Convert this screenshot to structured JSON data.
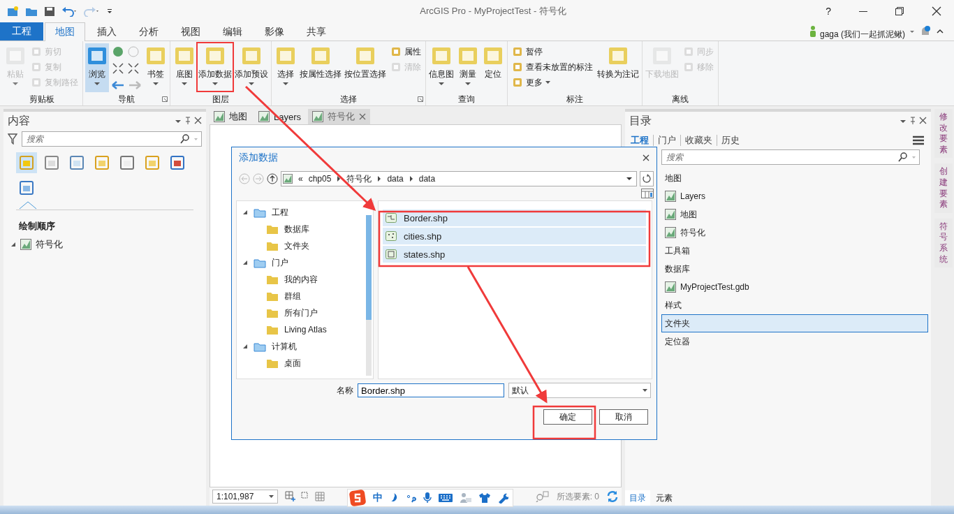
{
  "window": {
    "title": "ArcGIS Pro - MyProjectTest - 符号化",
    "help": "?"
  },
  "file_tab": "工程",
  "ribbon_tabs": [
    {
      "label": "地图",
      "selected": true
    },
    {
      "label": "插入",
      "selected": false
    },
    {
      "label": "分析",
      "selected": false
    },
    {
      "label": "视图",
      "selected": false
    },
    {
      "label": "编辑",
      "selected": false
    },
    {
      "label": "影像",
      "selected": false
    },
    {
      "label": "共享",
      "selected": false
    }
  ],
  "user": {
    "name": "gaga (我们一起抓泥鳅)"
  },
  "ribbon_groups": [
    {
      "label": "剪贴板",
      "launcher": false,
      "buttons": [
        {
          "label": "粘贴",
          "kind": "large",
          "disabled": true,
          "pressed": false,
          "dropdown": true
        },
        {
          "label": "剪切",
          "kind": "small",
          "disabled": true,
          "pressed": false,
          "dropdown": false
        },
        {
          "label": "复制",
          "kind": "small",
          "disabled": true,
          "pressed": false,
          "dropdown": false
        },
        {
          "label": "复制路径",
          "kind": "small",
          "disabled": true,
          "pressed": false,
          "dropdown": false
        }
      ]
    },
    {
      "label": "导航",
      "launcher": true,
      "buttons": [
        {
          "label": "浏览",
          "kind": "large",
          "disabled": false,
          "pressed": true,
          "dropdown": true
        },
        {
          "kind": "nav_cluster"
        },
        {
          "label": "书签",
          "kind": "large",
          "disabled": false,
          "pressed": false,
          "dropdown": true
        }
      ]
    },
    {
      "label": "图层",
      "launcher": false,
      "buttons": [
        {
          "label": "底图",
          "kind": "large",
          "disabled": false,
          "pressed": false,
          "dropdown": true
        },
        {
          "label": "添加数据",
          "kind": "large",
          "disabled": false,
          "pressed": false,
          "dropdown": true
        },
        {
          "label": "添加预设",
          "kind": "large",
          "disabled": false,
          "pressed": false,
          "dropdown": true
        }
      ]
    },
    {
      "label": "选择",
      "launcher": true,
      "buttons": [
        {
          "label": "选择",
          "kind": "large",
          "disabled": false,
          "pressed": false,
          "dropdown": true
        },
        {
          "label": "按属性选择",
          "kind": "large",
          "disabled": false,
          "pressed": false,
          "dropdown": false
        },
        {
          "label": "按位置选择",
          "kind": "large",
          "disabled": false,
          "pressed": false,
          "dropdown": false
        },
        {
          "label": "属性",
          "kind": "small",
          "disabled": false,
          "pressed": false,
          "dropdown": false
        },
        {
          "label": "清除",
          "kind": "small",
          "disabled": true,
          "pressed": false,
          "dropdown": false
        }
      ]
    },
    {
      "label": "查询",
      "launcher": false,
      "buttons": [
        {
          "label": "信息图",
          "kind": "large",
          "disabled": false,
          "pressed": false,
          "dropdown": true
        },
        {
          "label": "测量",
          "kind": "large",
          "disabled": false,
          "pressed": false,
          "dropdown": true
        },
        {
          "label": "定位",
          "kind": "large",
          "disabled": false,
          "pressed": false,
          "dropdown": false
        }
      ]
    },
    {
      "label": "标注",
      "launcher": false,
      "buttons": [
        {
          "label": "暂停",
          "kind": "small",
          "disabled": false,
          "pressed": false,
          "dropdown": false
        },
        {
          "label": "查看未放置的标注",
          "kind": "small",
          "disabled": false,
          "pressed": false,
          "dropdown": false
        },
        {
          "label": "更多",
          "kind": "small",
          "disabled": false,
          "pressed": false,
          "dropdown": true
        },
        {
          "label": "转换为注记",
          "kind": "large",
          "disabled": false,
          "pressed": false,
          "dropdown": false
        }
      ]
    },
    {
      "label": "离线",
      "launcher": false,
      "buttons": [
        {
          "label": "下载地图",
          "kind": "large",
          "disabled": true,
          "pressed": false,
          "dropdown": false
        },
        {
          "label": "同步",
          "kind": "small",
          "disabled": true,
          "pressed": false,
          "dropdown": false
        },
        {
          "label": "移除",
          "kind": "small",
          "disabled": true,
          "pressed": false,
          "dropdown": false
        }
      ]
    }
  ],
  "contents_pane": {
    "title": "内容",
    "search": {
      "placeholder": "搜索"
    },
    "tools": [
      {
        "selected": true
      },
      {
        "selected": false
      },
      {
        "selected": false
      },
      {
        "selected": false
      },
      {
        "selected": false
      },
      {
        "selected": false
      },
      {
        "selected": false
      },
      {
        "selected": false
      }
    ],
    "heading": "绘制顺序",
    "tree": [
      {
        "label": "符号化",
        "expanded": true
      }
    ]
  },
  "view_tabs": [
    {
      "label": "地图",
      "selected": false,
      "closable": false
    },
    {
      "label": "Layers",
      "selected": false,
      "closable": false
    },
    {
      "label": "符号化",
      "selected": true,
      "closable": true
    }
  ],
  "status_bar": {
    "scale": "1:101,987",
    "selected_features": "所选要素: 0"
  },
  "dialog": {
    "title": "添加数据",
    "breadcrumb": [
      "«",
      "chp05",
      "符号化",
      "data",
      "data"
    ],
    "tree": [
      {
        "label": "工程",
        "expanded": true,
        "children": [
          {
            "label": "数据库"
          },
          {
            "label": "文件夹"
          }
        ]
      },
      {
        "label": "门户",
        "expanded": true,
        "children": [
          {
            "label": "我的内容"
          },
          {
            "label": "群组"
          },
          {
            "label": "所有门户"
          },
          {
            "label": "Living Atlas"
          }
        ]
      },
      {
        "label": "计算机",
        "expanded": true,
        "children": [
          {
            "label": "桌面"
          }
        ]
      }
    ],
    "files": [
      {
        "name": "Border.shp",
        "kind": "line",
        "selected": true
      },
      {
        "name": "cities.shp",
        "kind": "point",
        "selected": true
      },
      {
        "name": "states.shp",
        "kind": "polygon",
        "selected": true
      }
    ],
    "name_label": "名称",
    "name_value": "Border.shp",
    "filter": "默认",
    "buttons": [
      "确定",
      "取消"
    ]
  },
  "catalog_pane": {
    "title": "目录",
    "tabs": [
      {
        "label": "工程",
        "selected": true
      },
      {
        "label": "门户",
        "selected": false
      },
      {
        "label": "收藏夹",
        "selected": false
      },
      {
        "label": "历史",
        "selected": false
      }
    ],
    "search": {
      "placeholder": "搜索"
    },
    "tree": [
      {
        "label": "地图",
        "selected": false,
        "children": [
          {
            "label": "Layers",
            "selected": false
          },
          {
            "label": "地图",
            "selected": false
          },
          {
            "label": "符号化",
            "selected": false
          }
        ]
      },
      {
        "label": "工具箱",
        "selected": false
      },
      {
        "label": "数据库",
        "selected": false,
        "children": [
          {
            "label": "MyProjectTest.gdb",
            "selected": false
          }
        ]
      },
      {
        "label": "样式",
        "selected": false
      },
      {
        "label": "文件夹",
        "selected": true
      },
      {
        "label": "定位器",
        "selected": false
      }
    ],
    "bottom_tabs": [
      {
        "label": "目录",
        "selected": true
      },
      {
        "label": "元素",
        "selected": false
      }
    ]
  },
  "side_tabs": [
    "修改要素",
    "创建要素",
    "符号系统"
  ],
  "ime_toolbar": {
    "mode": "中"
  }
}
